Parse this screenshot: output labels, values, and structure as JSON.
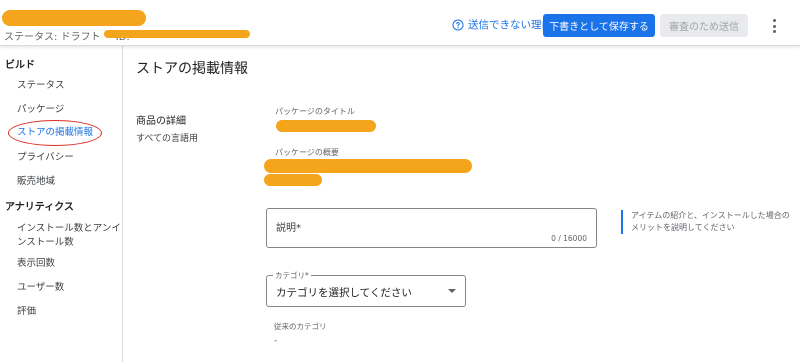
{
  "header": {
    "status_label": "ステータス: ドラフト",
    "id_label": "ID:",
    "why_not_send": "送信できない理由",
    "save_draft": "下書きとして保存する",
    "submit_review": "審査のため送信"
  },
  "sidebar": {
    "build_header": "ビルド",
    "build_items": [
      "ステータス",
      "パッケージ",
      "ストアの掲載情報",
      "プライバシー",
      "販売地域"
    ],
    "analytics_header": "アナリティクス",
    "analytics_items": [
      "インストール数とアンインストール数",
      "表示回数",
      "ユーザー数",
      "評価"
    ]
  },
  "main": {
    "page_title": "ストアの掲載情報",
    "section_title": "商品の詳細",
    "section_subtitle": "すべての言語用",
    "package_title_label": "パッケージのタイトル",
    "package_summary_label": "パッケージの概要",
    "description_label": "説明*",
    "description_counter": "0 / 16000",
    "description_help": "アイテムの紹介と、インストールした場合のメリットを説明してください",
    "category_label": "カテゴリ*",
    "category_placeholder": "カテゴリを選択してください",
    "legacy_category_label": "従来のカテゴリ",
    "legacy_category_value": "-"
  },
  "colors": {
    "accent": "#1a73e8",
    "redaction": "#f4a51c",
    "annotation": "#d93025"
  }
}
